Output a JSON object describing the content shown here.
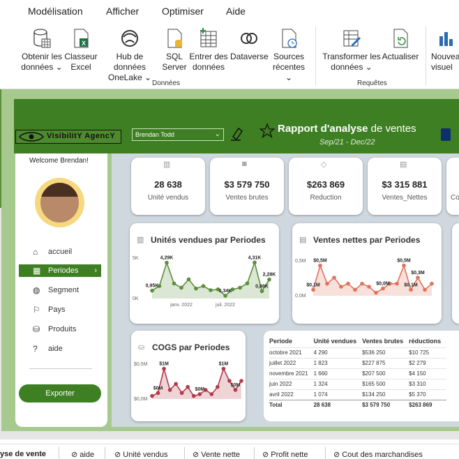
{
  "menu": [
    "Modélisation",
    "Afficher",
    "Optimiser",
    "Aide"
  ],
  "ribbon": {
    "buttons": [
      {
        "label1": "Obtenir les",
        "label2": "données ⌄",
        "icon": "database-icon"
      },
      {
        "label1": "Classeur",
        "label2": "Excel",
        "icon": "excel-icon"
      },
      {
        "label1": "Hub de données",
        "label2": "OneLake ⌄",
        "icon": "onelake-icon"
      },
      {
        "label1": "SQL",
        "label2": "Server",
        "icon": "sql-server-icon"
      },
      {
        "label1": "Entrer des",
        "label2": "données",
        "icon": "table-icon"
      },
      {
        "label1": "Dataverse",
        "label2": "",
        "icon": "dataverse-icon"
      },
      {
        "label1": "Sources",
        "label2": "récentes ⌄",
        "icon": "recent-sources-icon"
      },
      {
        "label1": "Transformer les",
        "label2": "données ⌄",
        "icon": "transform-icon"
      },
      {
        "label1": "Actualiser",
        "label2": "",
        "icon": "refresh-icon"
      },
      {
        "label1": "Nouvea",
        "label2": "visuel",
        "icon": "new-visual-icon"
      }
    ],
    "groups": [
      "Données",
      "Requêtes"
    ]
  },
  "report": {
    "logo_text": "VisibilitY AgencY",
    "user_select": "Brendan Todd",
    "title_bold": "Rapport d'analyse",
    "title_rest": " de ventes",
    "date_range": "Sep/21 - Dec/22",
    "welcome": "Welcome Brendan!",
    "nav": [
      {
        "label": "accueil",
        "icon": "home-icon"
      },
      {
        "label": "Periodes",
        "icon": "calendar-icon"
      },
      {
        "label": "Segment",
        "icon": "globe-icon"
      },
      {
        "label": "Pays",
        "icon": "flag-icon"
      },
      {
        "label": "Produits",
        "icon": "products-icon"
      },
      {
        "label": "aide",
        "icon": "help-icon"
      }
    ],
    "export_label": "Exporter",
    "kpis": [
      {
        "value": "28 638",
        "label": "Unité vendus"
      },
      {
        "value": "$3 579 750",
        "label": "Ventes brutes"
      },
      {
        "value": "$263 869",
        "label": "Reduction"
      },
      {
        "value": "$3 315 881",
        "label": "Ventes_Nettes"
      },
      {
        "value": "",
        "label": "Co"
      }
    ],
    "chart_titles": [
      "Unités vendues par Periodes",
      "Ventes nettes par Periodes",
      "COGS par Periodes"
    ],
    "table": {
      "headers": [
        "Periode",
        "Unité vendues",
        "Ventes brutes",
        "réductions"
      ],
      "rows": [
        [
          "octobre 2021",
          "4 290",
          "$536 250",
          "$10 725"
        ],
        [
          "juillet 2022",
          "1 823",
          "$227 875",
          "$2 279"
        ],
        [
          "novembre 2021",
          "1 660",
          "$207 500",
          "$4 150"
        ],
        [
          "juin 2022",
          "1 324",
          "$165 500",
          "$3 310"
        ],
        [
          "avril 2022",
          "1 074",
          "$134 250",
          "$5 370"
        ]
      ],
      "total": [
        "Total",
        "28 638",
        "$3 579 750",
        "$263 869"
      ]
    }
  },
  "chart_data": [
    {
      "type": "area",
      "title": "Unités vendues par Periodes",
      "y_ticks": [
        "5K",
        "0K"
      ],
      "x_ticks": [
        "janv. 2022",
        "juil. 2022"
      ],
      "ylim": [
        0,
        5000
      ],
      "values": [
        950,
        1500,
        4290,
        1800,
        1300,
        2300,
        1200,
        1500,
        1000,
        1100,
        340,
        1100,
        1300,
        1820,
        4310,
        880,
        2280
      ],
      "data_labels": [
        {
          "index": 0,
          "text": "0,95K"
        },
        {
          "index": 2,
          "text": "4,29K"
        },
        {
          "index": 10,
          "text": "0,34K"
        },
        {
          "index": 14,
          "text": "4,31K"
        },
        {
          "index": 15,
          "text": "0,88K"
        },
        {
          "index": 16,
          "text": "2,28K"
        }
      ],
      "color": "#5b8f3a"
    },
    {
      "type": "area",
      "title": "Ventes nettes par Periodes",
      "y_ticks": [
        "0,5M",
        "0,0M"
      ],
      "ylim": [
        0,
        0.6
      ],
      "values": [
        0.1,
        0.5,
        0.2,
        0.3,
        0.15,
        0.2,
        0.1,
        0.2,
        0.15,
        0.05,
        0.12,
        0.2,
        0.2,
        0.5,
        0.1,
        0.3,
        0.1,
        0.2
      ],
      "data_labels": [
        {
          "index": 0,
          "text": "$0,1M"
        },
        {
          "index": 1,
          "text": "$0,5M"
        },
        {
          "index": 10,
          "text": "$0,0M"
        },
        {
          "index": 13,
          "text": "$0,5M"
        },
        {
          "index": 14,
          "text": "$0,1M"
        },
        {
          "index": 15,
          "text": "$0,3M"
        }
      ],
      "color": "#e0735c"
    },
    {
      "type": "area",
      "title": "COGS par Periodes",
      "y_ticks": [
        "$0,5M",
        "$0,0M"
      ],
      "ylim": [
        0,
        0.6
      ],
      "values": [
        0.05,
        0.1,
        0.5,
        0.15,
        0.25,
        0.1,
        0.2,
        0.05,
        0.08,
        0.15,
        0.08,
        0.2,
        0.5,
        0.3,
        0.15,
        0.3
      ],
      "data_labels": [
        {
          "index": 1,
          "text": "$0M"
        },
        {
          "index": 2,
          "text": "$1M"
        },
        {
          "index": 8,
          "text": "$0M"
        },
        {
          "index": 12,
          "text": "$1M"
        },
        {
          "index": 14,
          "text": "$0M"
        }
      ],
      "color": "#b23a48"
    }
  ],
  "bottom_tabs": [
    "yse de vente",
    "aide",
    "Unité vendus",
    "Vente nette",
    "Profit nette",
    "Cout des marchandises"
  ]
}
